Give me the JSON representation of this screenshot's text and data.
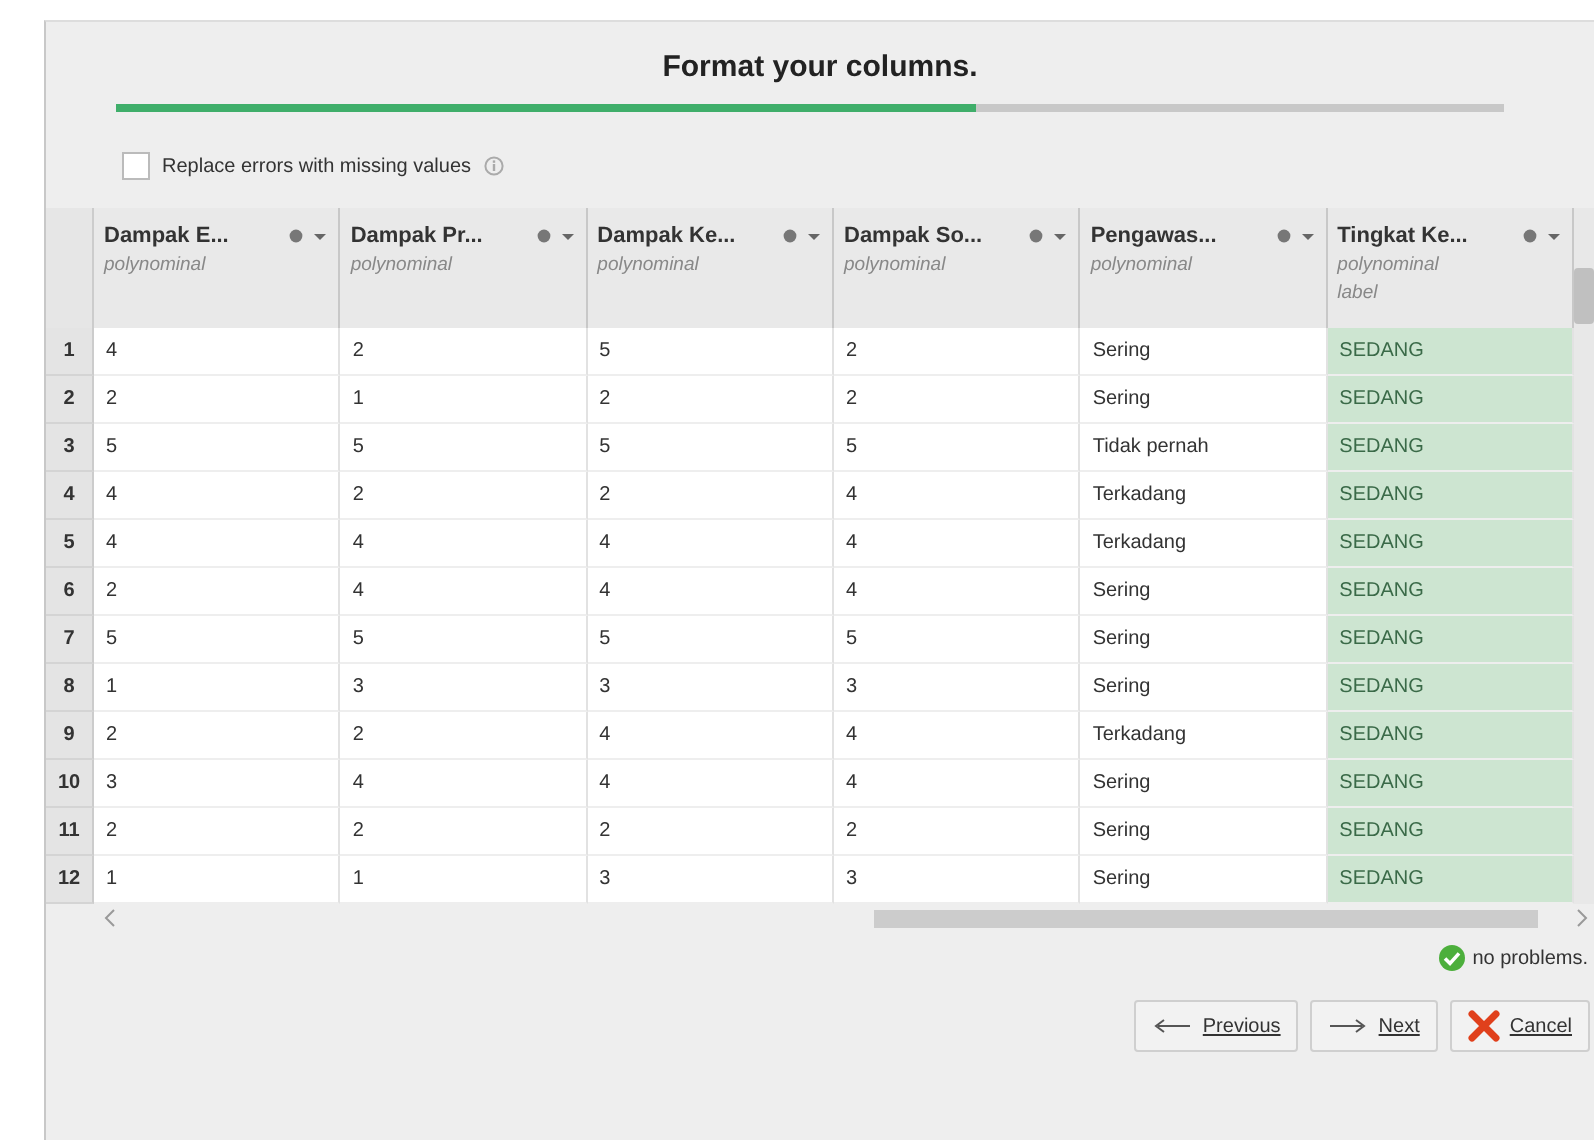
{
  "title": "Format your columns.",
  "progress": {
    "level": 0.62
  },
  "replace_errors": {
    "label": "Replace errors with missing values",
    "checked": false
  },
  "table": {
    "columns": [
      {
        "name": "Dampak E...",
        "type": "polynominal",
        "label_role": false
      },
      {
        "name": "Dampak Pr...",
        "type": "polynominal",
        "label_role": false
      },
      {
        "name": "Dampak Ke...",
        "type": "polynominal",
        "label_role": false
      },
      {
        "name": "Dampak So...",
        "type": "polynominal",
        "label_role": false
      },
      {
        "name": "Pengawas...",
        "type": "polynominal",
        "label_role": false
      },
      {
        "name": "Tingkat Ke...",
        "type": "polynominal",
        "role": "label",
        "label_role": true
      }
    ],
    "rows": [
      {
        "number": "1",
        "cells": [
          "4",
          "2",
          "5",
          "2",
          "Sering",
          "SEDANG"
        ]
      },
      {
        "number": "2",
        "cells": [
          "2",
          "1",
          "2",
          "2",
          "Sering",
          "SEDANG"
        ]
      },
      {
        "number": "3",
        "cells": [
          "5",
          "5",
          "5",
          "5",
          "Tidak pernah",
          "SEDANG"
        ]
      },
      {
        "number": "4",
        "cells": [
          "4",
          "2",
          "2",
          "4",
          "Terkadang",
          "SEDANG"
        ]
      },
      {
        "number": "5",
        "cells": [
          "4",
          "4",
          "4",
          "4",
          "Terkadang",
          "SEDANG"
        ]
      },
      {
        "number": "6",
        "cells": [
          "2",
          "4",
          "4",
          "4",
          "Sering",
          "SEDANG"
        ]
      },
      {
        "number": "7",
        "cells": [
          "5",
          "5",
          "5",
          "5",
          "Sering",
          "SEDANG"
        ]
      },
      {
        "number": "8",
        "cells": [
          "1",
          "3",
          "3",
          "3",
          "Sering",
          "SEDANG"
        ]
      },
      {
        "number": "9",
        "cells": [
          "2",
          "2",
          "4",
          "4",
          "Terkadang",
          "SEDANG"
        ]
      },
      {
        "number": "10",
        "cells": [
          "3",
          "4",
          "4",
          "4",
          "Sering",
          "SEDANG"
        ]
      },
      {
        "number": "11",
        "cells": [
          "2",
          "2",
          "2",
          "2",
          "Sering",
          "SEDANG"
        ]
      },
      {
        "number": "12",
        "cells": [
          "1",
          "1",
          "3",
          "3",
          "Sering",
          "SEDANG"
        ]
      }
    ]
  },
  "status": {
    "text": "no problems.",
    "ok": true
  },
  "buttons": [
    {
      "kind": "previous",
      "label": "Previous"
    },
    {
      "kind": "next",
      "label": "Next"
    },
    {
      "kind": "cancel",
      "label": "Cancel"
    }
  ]
}
